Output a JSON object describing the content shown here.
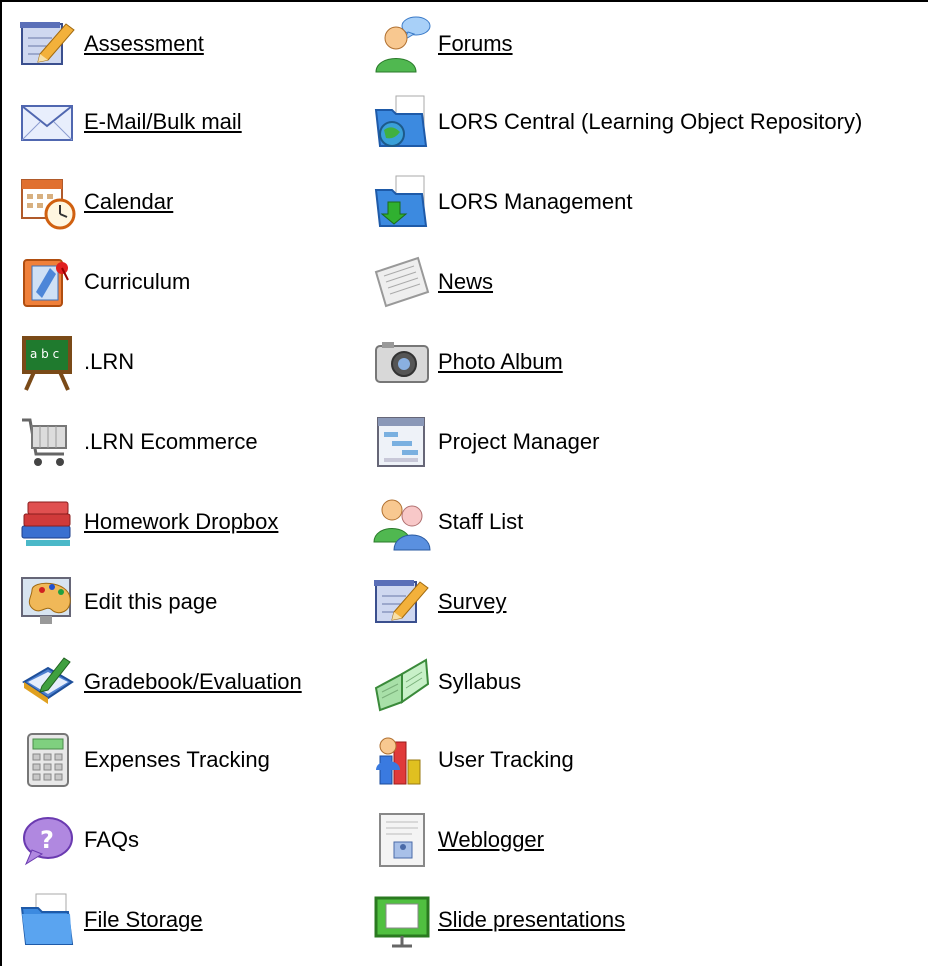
{
  "left_column": [
    {
      "label": "Assessment",
      "link": true,
      "icon": "assessment-icon"
    },
    {
      "label": "E-Mail/Bulk mail",
      "link": true,
      "icon": "email-icon"
    },
    {
      "label": "Calendar",
      "link": true,
      "icon": "calendar-icon"
    },
    {
      "label": "Curriculum",
      "link": false,
      "icon": "curriculum-icon"
    },
    {
      "label": ".LRN",
      "link": false,
      "icon": "chalkboard-icon"
    },
    {
      "label": ".LRN Ecommerce",
      "link": false,
      "icon": "shopping-cart-icon"
    },
    {
      "label": "Homework Dropbox",
      "link": true,
      "icon": "books-icon"
    },
    {
      "label": "Edit this page",
      "link": false,
      "icon": "paint-palette-icon"
    },
    {
      "label": "Gradebook/Evaluation",
      "link": true,
      "icon": "gradebook-icon"
    },
    {
      "label": "Expenses Tracking",
      "link": false,
      "icon": "calculator-icon"
    },
    {
      "label": "FAQs",
      "link": false,
      "icon": "question-bubble-icon"
    },
    {
      "label": "File Storage",
      "link": true,
      "icon": "folder-icon"
    }
  ],
  "right_column": [
    {
      "label": "Forums",
      "link": true,
      "icon": "forum-user-icon"
    },
    {
      "label": "LORS Central (Learning Object Repository)",
      "link": false,
      "icon": "folder-globe-icon"
    },
    {
      "label": "LORS Management",
      "link": false,
      "icon": "folder-arrow-icon"
    },
    {
      "label": "News",
      "link": true,
      "icon": "newspaper-icon"
    },
    {
      "label": "Photo Album",
      "link": true,
      "icon": "camera-icon"
    },
    {
      "label": "Project Manager",
      "link": false,
      "icon": "project-chart-icon"
    },
    {
      "label": "Staff List",
      "link": false,
      "icon": "users-icon"
    },
    {
      "label": "Survey",
      "link": true,
      "icon": "survey-icon"
    },
    {
      "label": "Syllabus",
      "link": false,
      "icon": "open-book-icon"
    },
    {
      "label": "User Tracking",
      "link": false,
      "icon": "bar-chart-icon"
    },
    {
      "label": "Weblogger",
      "link": true,
      "icon": "weblog-icon"
    },
    {
      "label": "Slide presentations",
      "link": true,
      "icon": "presentation-icon"
    }
  ]
}
